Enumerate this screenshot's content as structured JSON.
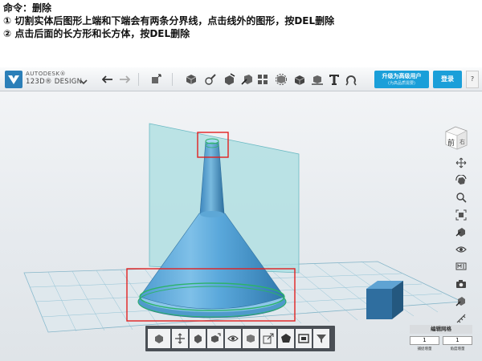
{
  "instructions": {
    "line1": "命令：删除",
    "line2": "①  切割实体后图形上端和下端会有两条分界线，点击线外的图形，按DEL删除",
    "line3": "②  点击后面的长方形和长方体，按DEL删除"
  },
  "app": {
    "brand_top": "AUTODESK®",
    "brand_name": "123D® DESIGN",
    "upgrade_label": "升级为高级用户",
    "upgrade_sub": "(为高品质需要)",
    "login_label": "登录",
    "help_label": "?"
  },
  "viewcube": {
    "face_label": "前",
    "side_label": "右"
  },
  "grid_panel": {
    "title": "编辑网格",
    "snap_value": "1",
    "grid_value": "1",
    "snap_label": "捕捉增量",
    "grid_label": "角度增量"
  },
  "toolbar_icons": [
    "chevron-down-icon",
    "undo-icon",
    "redo-icon",
    "transform-icon",
    "primitives-icon",
    "sketch-icon",
    "construct-icon",
    "modify-icon",
    "pattern-icon",
    "group-icon",
    "combine-icon",
    "measure-icon",
    "text-icon",
    "snap-icon"
  ],
  "colors": {
    "accent": "#1a9fd9",
    "model": "#3e8fc3",
    "plane": "#a9dde0",
    "highlight": "#e22020",
    "grid": "#6fb3c9"
  }
}
